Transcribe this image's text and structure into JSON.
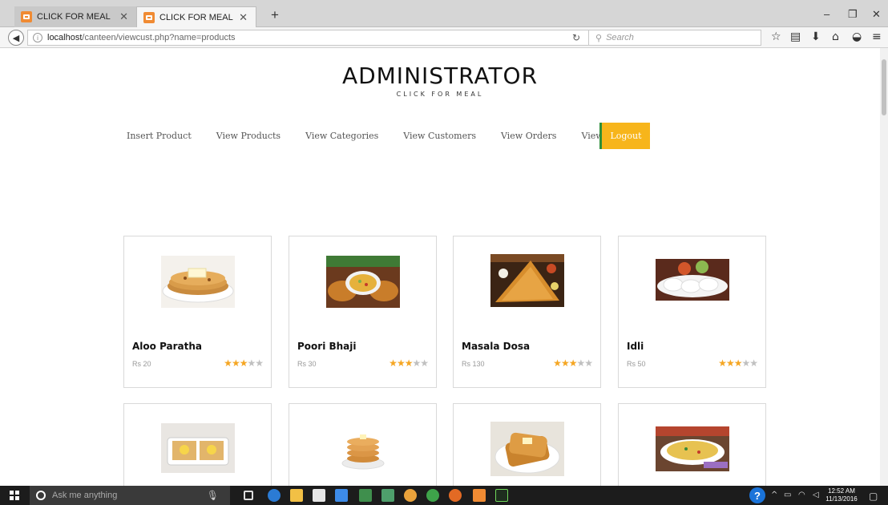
{
  "browser": {
    "tabs": [
      {
        "label": "CLICK FOR MEAL",
        "active": false
      },
      {
        "label": "CLICK FOR MEAL",
        "active": true
      }
    ],
    "new_tab_symbol": "+",
    "url_host": "localhost",
    "url_path": "/canteen/viewcust.php?name=products",
    "search_placeholder": "Search",
    "window_controls": {
      "minimize": "–",
      "restore": "❐",
      "close": "✕"
    }
  },
  "header": {
    "title": "ADMINISTRATOR",
    "subtitle": "CLICK FOR MEAL"
  },
  "menu": {
    "items": [
      "Insert Product",
      "View Products",
      "View Categories",
      "View Customers",
      "View Orders",
      "View Payments"
    ],
    "logout": "Logout"
  },
  "products": [
    {
      "name": "Aloo Paratha",
      "price": "Rs 20",
      "rating": 2.5
    },
    {
      "name": "Poori Bhaji",
      "price": "Rs 30",
      "rating": 2.5
    },
    {
      "name": "Masala Dosa",
      "price": "Rs 130",
      "rating": 2.5
    },
    {
      "name": "Idli",
      "price": "Rs 50",
      "rating": 2.5
    }
  ],
  "taskbar": {
    "search_placeholder": "Ask me anything",
    "time": "12:52 AM",
    "date": "11/13/2016"
  },
  "colors": {
    "accent_logout": "#f7b51b",
    "logout_border": "#2f8f3a",
    "star_filled": "#f5a623",
    "star_empty": "#c0c0c0"
  }
}
